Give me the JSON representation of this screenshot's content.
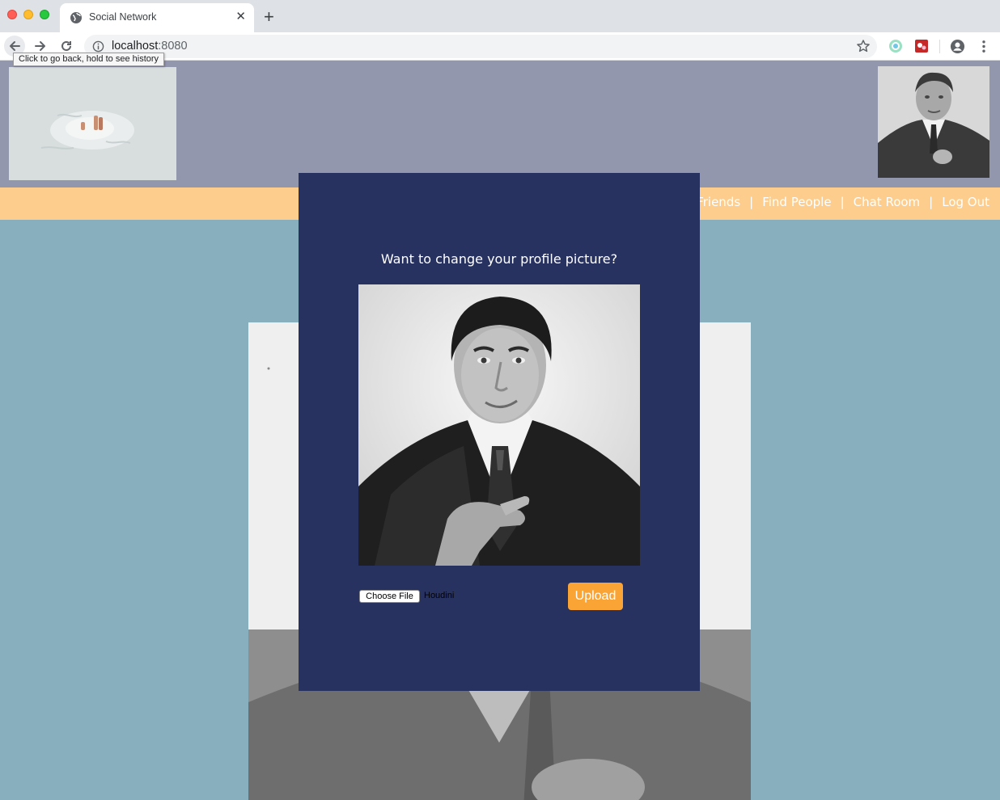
{
  "browser": {
    "tab_title": "Social Network",
    "url_host": "localhost",
    "url_port": ":8080",
    "tooltip": "Click to go back, hold to see history"
  },
  "nav": {
    "items": [
      {
        "label": "My Friends"
      },
      {
        "label": "Find People"
      },
      {
        "label": "Chat Room"
      },
      {
        "label": "Log Out"
      }
    ]
  },
  "modal": {
    "title": "Want to change your profile picture?",
    "choose_file_label": "Choose File",
    "file_name": "Houdini",
    "upload_label": "Upload"
  },
  "colors": {
    "header": "#9397ae",
    "navbar": "#fdcd8e",
    "background": "#87afbe",
    "modal": "#283260",
    "upload": "#faa435"
  }
}
